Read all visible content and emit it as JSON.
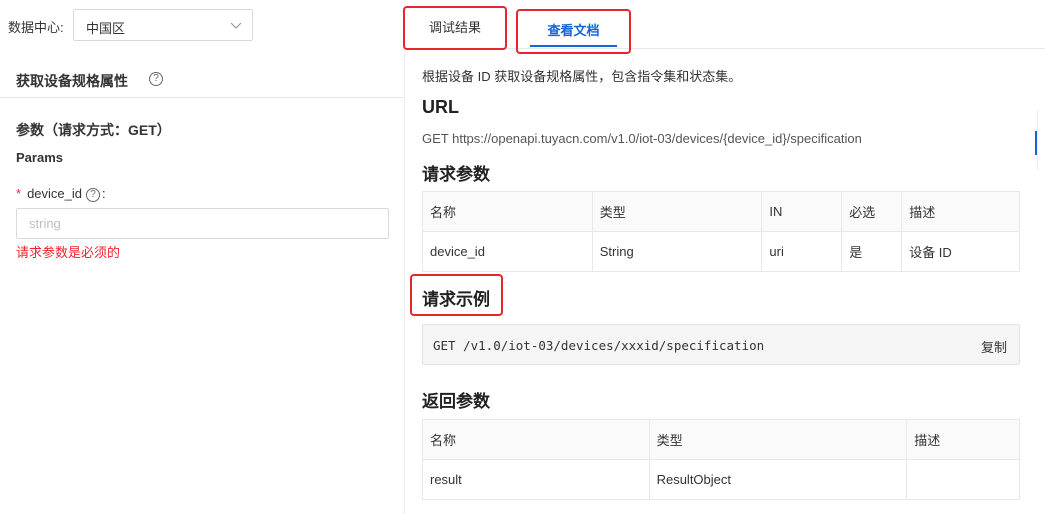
{
  "datacenter": {
    "label": "数据中心:",
    "selected": "中国区",
    "icon": "chevron-down-icon"
  },
  "left": {
    "title": "获取设备规格属性",
    "params_heading": "参数（请求方式：GET）",
    "params_sub": "Params",
    "field": {
      "required_mark": "*",
      "label": "device_id",
      "colon": ":",
      "placeholder": "string",
      "value": "",
      "error": "请求参数是必须的"
    }
  },
  "tabs": [
    {
      "label": "调试结果",
      "active": false
    },
    {
      "label": "查看文档",
      "active": true
    }
  ],
  "doc": {
    "description": "根据设备 ID 获取设备规格属性，包含指令集和状态集。",
    "url_heading": "URL",
    "url": "GET https://openapi.tuyacn.com/v1.0/iot-03/devices/{device_id}/specification",
    "req_params_heading": "请求参数",
    "req_table": {
      "headers": [
        "名称",
        "类型",
        "IN",
        "必选",
        "描述"
      ],
      "rows": [
        [
          "device_id",
          "String",
          "uri",
          "是",
          "设备 ID"
        ]
      ]
    },
    "req_example_heading": "请求示例",
    "code": "GET /v1.0/iot-03/devices/xxxid/specification",
    "copy_label": "复制",
    "resp_params_heading": "返回参数",
    "resp_table": {
      "headers": [
        "名称",
        "类型",
        "描述"
      ],
      "rows": [
        [
          "result",
          "ResultObject",
          ""
        ]
      ]
    }
  },
  "colors": {
    "accent": "#1565d8",
    "error": "#f5222d",
    "highlight_box": "#e6252d"
  }
}
